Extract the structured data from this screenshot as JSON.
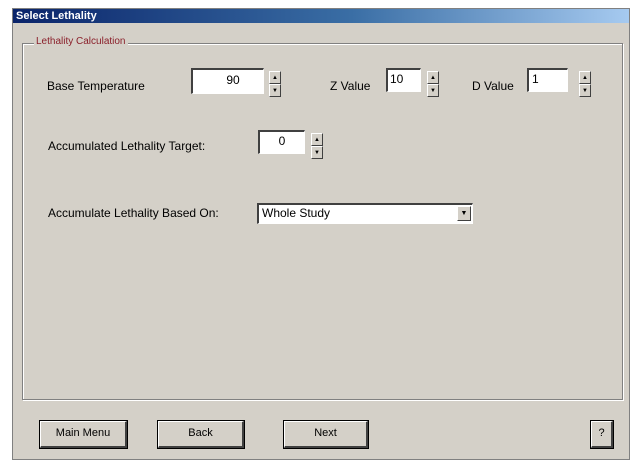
{
  "window": {
    "title": "Select Lethality"
  },
  "group": {
    "legend": "Lethality Calculation"
  },
  "base_temperature": {
    "label": "Base Temperature",
    "value": "90"
  },
  "z_value": {
    "label": "Z Value",
    "value": "10"
  },
  "d_value": {
    "label": "D Value",
    "value": "1"
  },
  "accumulated_target": {
    "label": "Accumulated Lethality Target:",
    "value": "0"
  },
  "accumulate_based_on": {
    "label": "Accumulate Lethality Based On:",
    "value": "Whole Study"
  },
  "buttons": {
    "main_menu": "Main Menu",
    "back": "Back",
    "next": "Next",
    "help": "?"
  },
  "icons": {
    "spin_up": "▲",
    "spin_down": "▼",
    "dropdown": "▼"
  }
}
